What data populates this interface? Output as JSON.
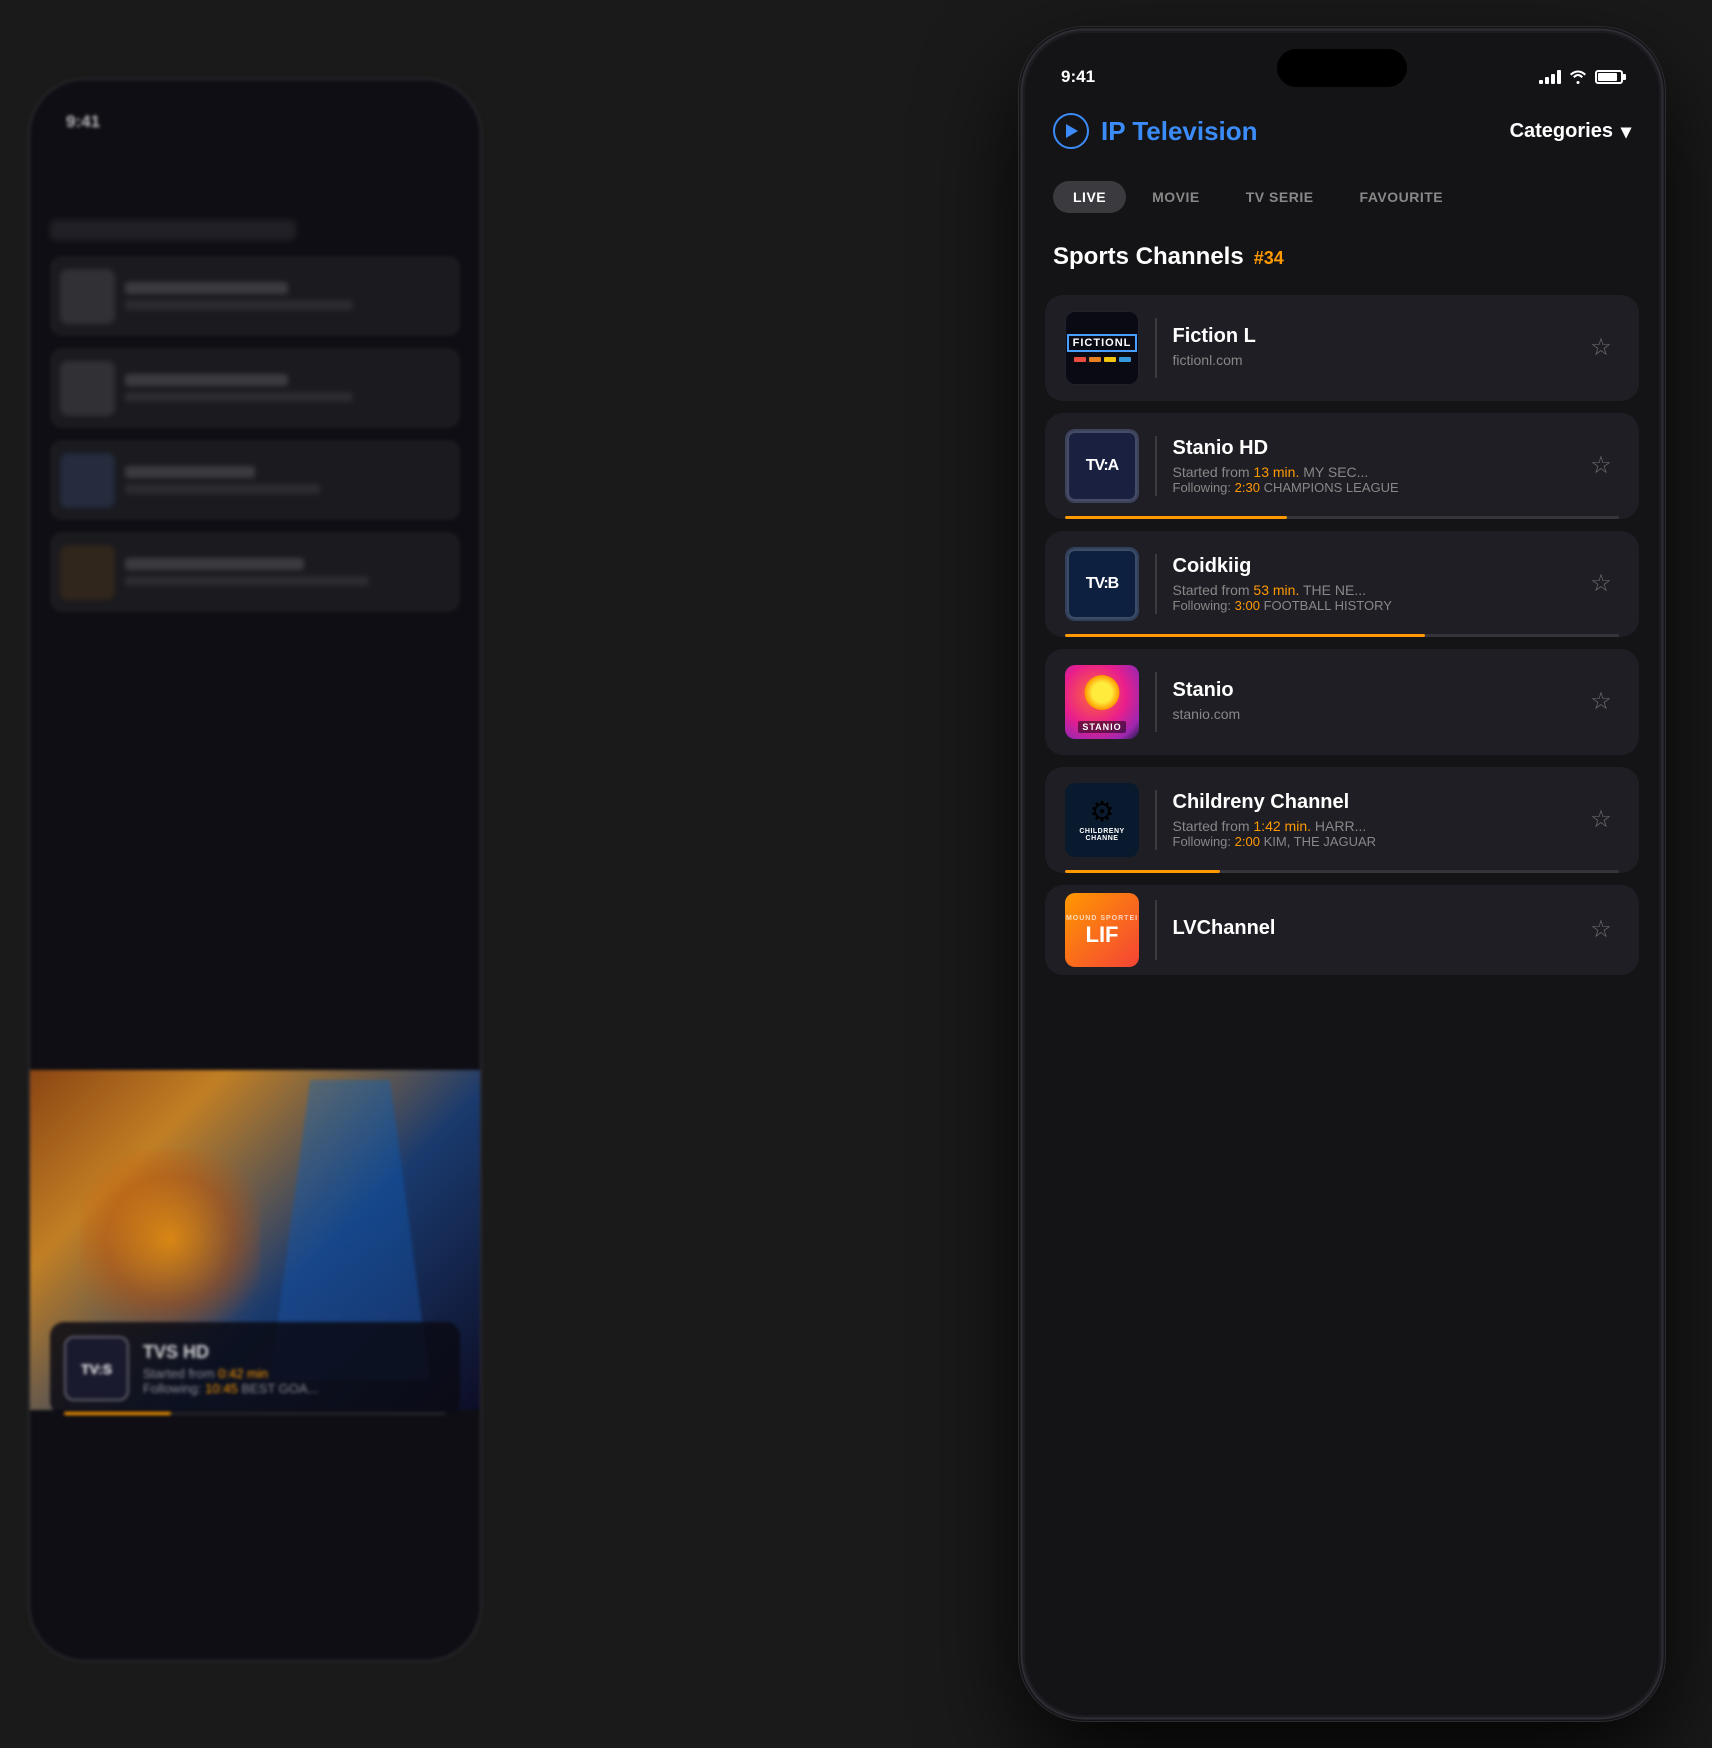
{
  "background": {
    "time": "9:41"
  },
  "phone": {
    "statusBar": {
      "time": "9:41",
      "signal": "4 bars",
      "wifi": true,
      "battery": "85%"
    },
    "header": {
      "appTitle": "IP Television",
      "playIcon": "play-circle",
      "categoriesLabel": "Categories",
      "chevron": "▾"
    },
    "tabs": [
      {
        "id": "live",
        "label": "LIVE",
        "active": true
      },
      {
        "id": "movie",
        "label": "MOVIE",
        "active": false
      },
      {
        "id": "tvserie",
        "label": "TV SERIE",
        "active": false
      },
      {
        "id": "favourite",
        "label": "FAVOURITE",
        "active": false
      }
    ],
    "section": {
      "title": "Sports Channels",
      "count": "#34"
    },
    "channels": [
      {
        "id": "fictionl",
        "name": "Fiction L",
        "subtitle": "fictionl.com",
        "logoType": "fictionl",
        "hasProgress": false,
        "progressPct": 0,
        "timeInfo": null,
        "following": null
      },
      {
        "id": "stanio-hd",
        "name": "Stanio HD",
        "subtitle": "Started from",
        "subtimeValue": "13 min.",
        "subtimeText": " MY SEC...",
        "following": "Following: ",
        "followingTime": "2:30",
        "followingText": " CHAMPIONS LEAGUE",
        "logoType": "tva",
        "hasProgress": true,
        "progressPct": 40
      },
      {
        "id": "coidkiig",
        "name": "Coidkiig",
        "subtitle": "Started from",
        "subtimeValue": "53 min.",
        "subtimeText": " THE NE...",
        "following": "Following: ",
        "followingTime": "3:00",
        "followingText": " FOOTBALL HISTORY",
        "logoType": "tvb",
        "hasProgress": true,
        "progressPct": 65
      },
      {
        "id": "stanio",
        "name": "Stanio",
        "subtitle": "stanio.com",
        "logoType": "stanio",
        "hasProgress": false,
        "progressPct": 0,
        "timeInfo": null,
        "following": null
      },
      {
        "id": "childreny",
        "name": "Childreny Channel",
        "subtitle": "Started from",
        "subtimeValue": "1:42 min.",
        "subtimeText": " HARR...",
        "following": "Following: ",
        "followingTime": "2:00",
        "followingText": " KIM, THE JAGUAR",
        "logoType": "childreny",
        "hasProgress": true,
        "progressPct": 28
      },
      {
        "id": "lvchannel",
        "name": "LVChannel",
        "subtitle": "",
        "logoType": "lvchannel",
        "hasProgress": false,
        "progressPct": 0,
        "timeInfo": null,
        "following": null
      }
    ],
    "bgCard": {
      "logoText": "TV:S",
      "title": "TVS HD",
      "sub1": "Started from ",
      "sub1time": "0:42 min",
      "sub1extra": " ...",
      "sub2": "Following: ",
      "sub2time": "10:45",
      "sub2text": " BEST GOA..."
    }
  }
}
